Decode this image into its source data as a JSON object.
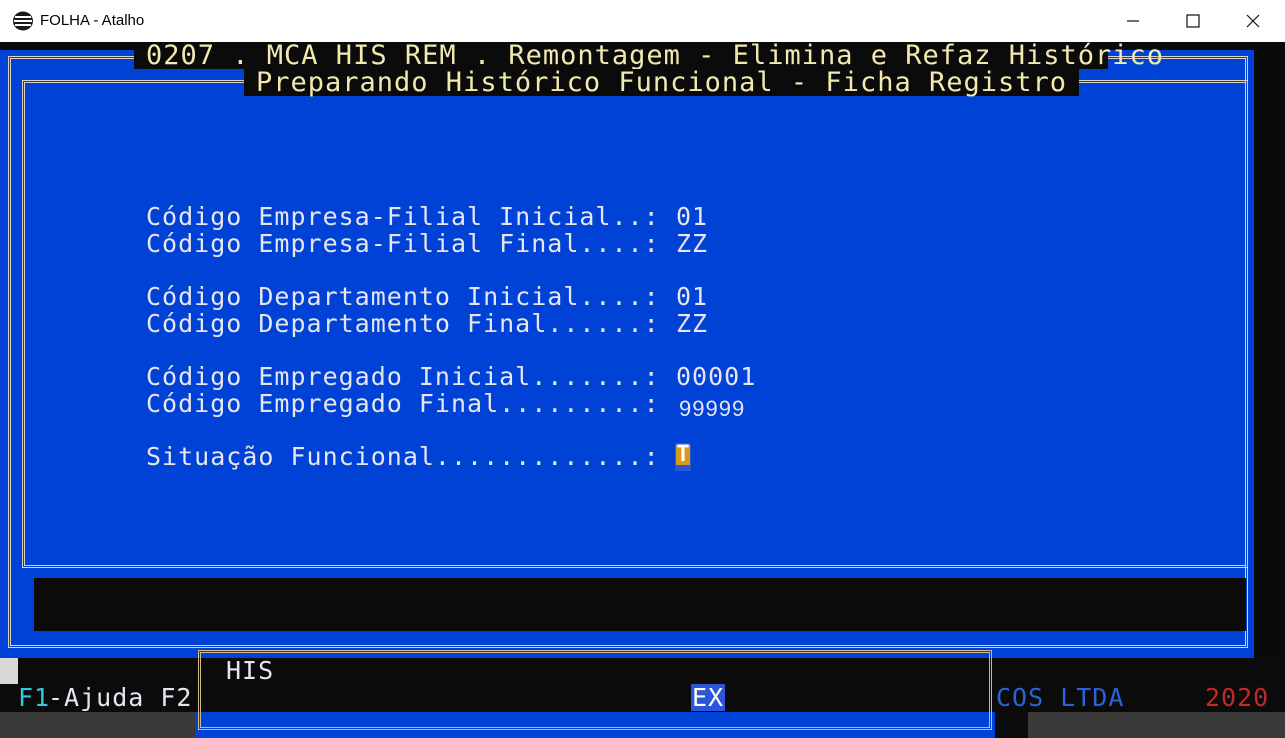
{
  "window": {
    "title": "FOLHA - Atalho",
    "icon": "folha-app-icon",
    "controls": [
      "minimize-icon",
      "maximize-icon",
      "close-icon"
    ]
  },
  "screen": {
    "header_line1": "0207 . MCA HIS REM . Remontagem - Elimina e Refaz Histórico",
    "header_line2": "Preparando Histórico Funcional - Ficha Registro",
    "fields": [
      {
        "label": "Código Empresa-Filial Inicial..:",
        "value": "01"
      },
      {
        "label": "Código Empresa-Filial Final....:",
        "value": "ZZ"
      },
      {
        "label": "Código Departamento Inicial....:",
        "value": "01"
      },
      {
        "label": "Código Departamento Final......:",
        "value": "ZZ"
      },
      {
        "label": "Código Empregado Inicial.......:",
        "value": "00001"
      },
      {
        "label": "Código Empregado Final.........:",
        "value": "99999"
      },
      {
        "label": "Situação Funcional.............:",
        "value": "T"
      }
    ]
  },
  "statusbar": {
    "his_label": "HIS",
    "f1_key": "F1",
    "f1_text": "-Ajuda F2",
    "ex_label": "EX",
    "company": "COS LTDA",
    "year": "2020"
  },
  "colors": {
    "screen_blue": "#0041d6",
    "header_text": "#f2e9b0",
    "cursor_bg": "#d99a1b",
    "year_red": "#c0282a",
    "company_blue": "#2a63d8"
  }
}
